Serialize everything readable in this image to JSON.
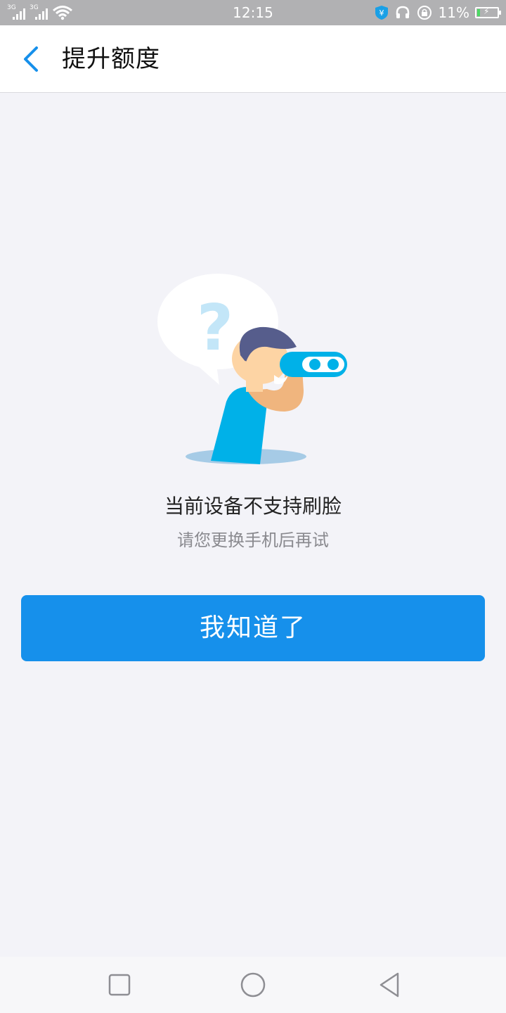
{
  "status_bar": {
    "network1": "3G",
    "network2": "3G",
    "time": "12:15",
    "battery_percent": "11%",
    "icons": [
      "signal-icon",
      "wifi-icon",
      "shield-yen-icon",
      "headset-icon",
      "rotation-lock-icon",
      "battery-icon"
    ]
  },
  "header": {
    "back_icon": "chevron-left-icon",
    "title": "提升额度"
  },
  "illustration": {
    "icon": "person-with-binoculars-question-illustration"
  },
  "message": {
    "title": "当前设备不支持刷脸",
    "subtitle": "请您更换手机后再试"
  },
  "button": {
    "label": "我知道了"
  },
  "nav_bar": {
    "items": [
      "recent-apps-icon",
      "home-icon",
      "back-icon"
    ]
  },
  "colors": {
    "accent": "#1690eb",
    "page_bg": "#f3f3f8",
    "status_bar_bg": "#b1b1b3"
  }
}
